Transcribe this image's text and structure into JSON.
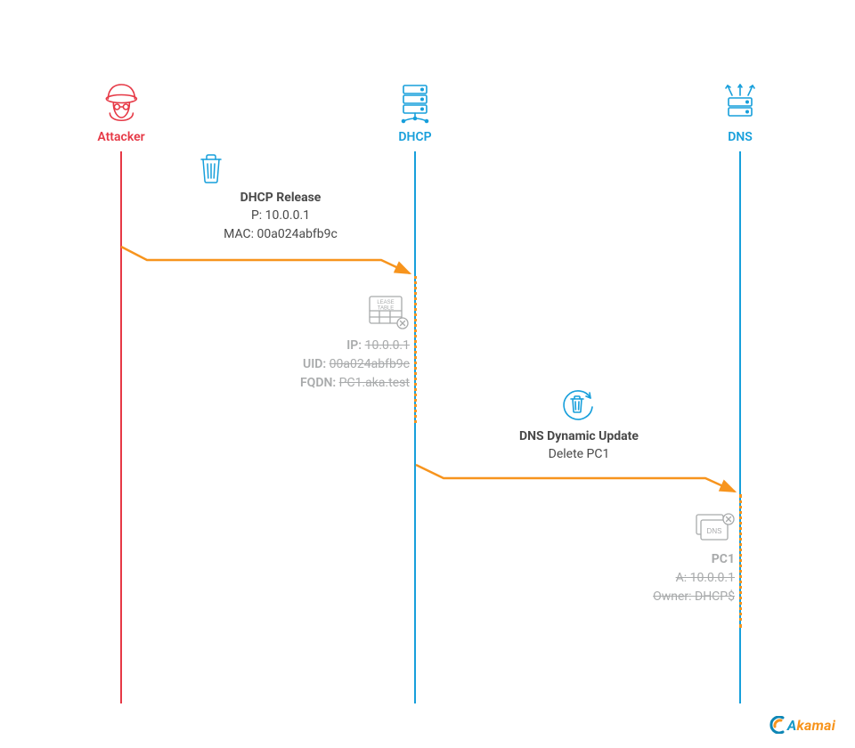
{
  "actors": {
    "attacker": {
      "label": "Attacker"
    },
    "dhcp": {
      "label": "DHCP"
    },
    "dns": {
      "label": "DNS"
    }
  },
  "msg1": {
    "title": "DHCP Release",
    "line1": "P: 10.0.0.1",
    "line2": "MAC: 00a024abfb9c"
  },
  "lease": {
    "icon_top": "LEASE",
    "icon_bottom": "TABLE",
    "ip_k": "IP: ",
    "ip_v": "10.0.0.1",
    "uid_k": "UID: ",
    "uid_v": "00a024abfb9c",
    "fqdn_k": "FQDN: ",
    "fqdn_v": "PC1.aka.test"
  },
  "msg2": {
    "title": "DNS Dynamic Update",
    "line1": "Delete PC1"
  },
  "dnsrec": {
    "icon_text": "DNS",
    "hdr": "PC1",
    "a": "A: 10.0.0.1",
    "own": "Owner: DHCP$"
  },
  "brand": {
    "name": "Akamai"
  }
}
